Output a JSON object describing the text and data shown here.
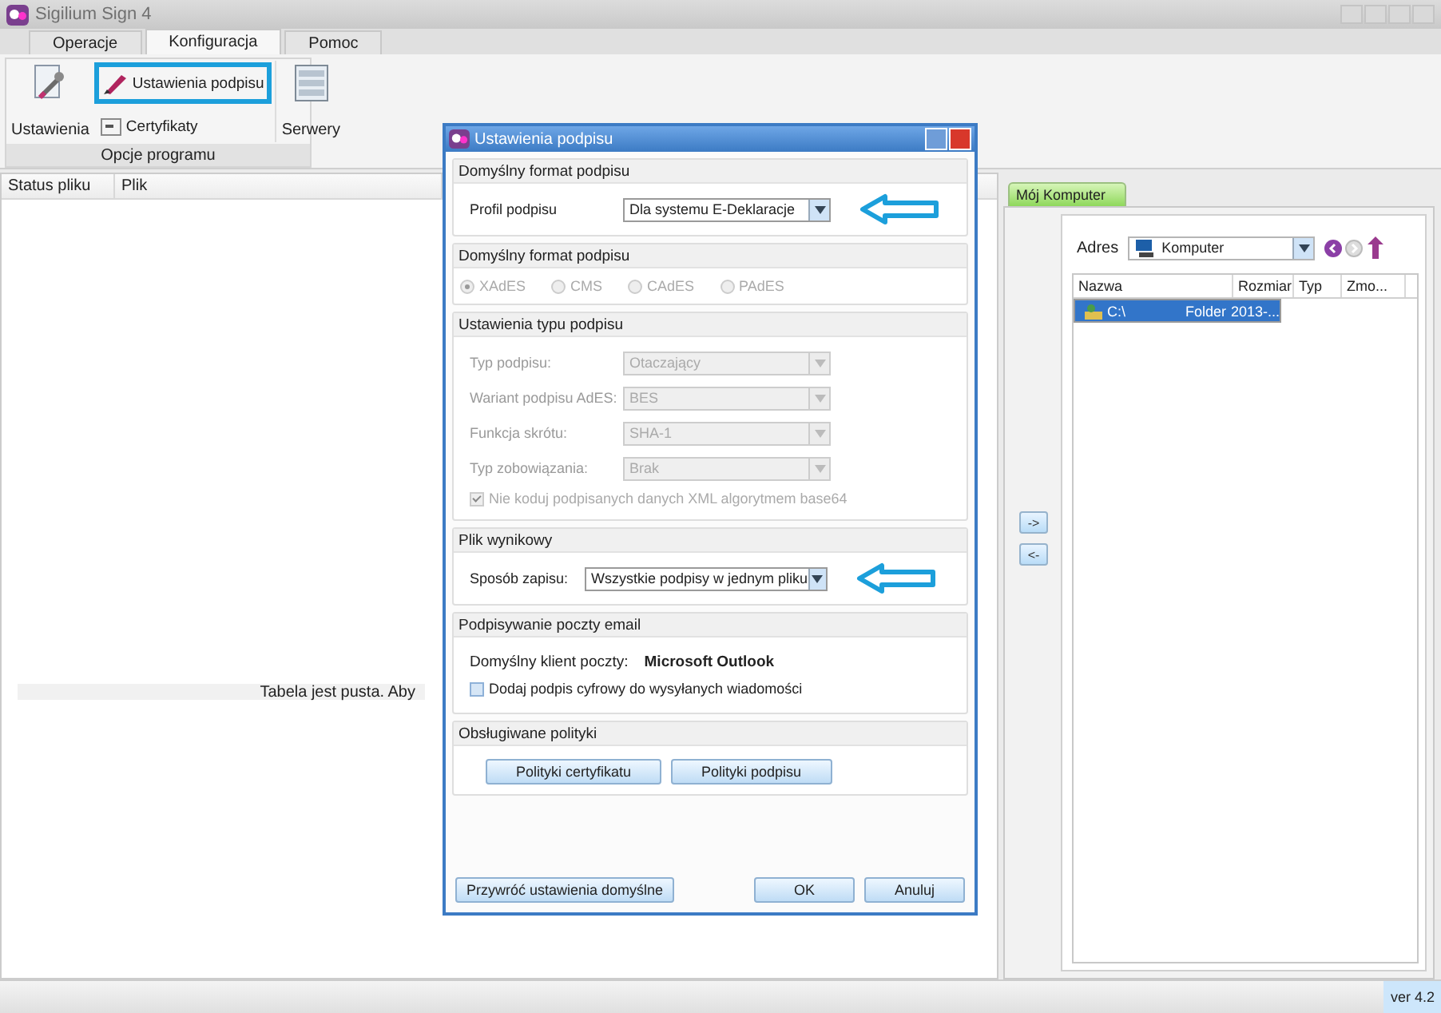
{
  "window": {
    "title": "Sigilium Sign 4"
  },
  "tabs": [
    {
      "label": "Operacje",
      "selected": false
    },
    {
      "label": "Konfiguracja",
      "selected": true
    },
    {
      "label": "Pomoc",
      "selected": false
    }
  ],
  "ribbon": {
    "group_label": "Opcje programu",
    "items": [
      {
        "kind": "large",
        "label": "Ustawienia",
        "highlighted": false
      },
      {
        "kind": "small",
        "label": "Ustawienia podpisu",
        "highlighted": true
      },
      {
        "kind": "small",
        "label": "Certyfikaty",
        "highlighted": false
      },
      {
        "kind": "large",
        "label": "Serwery",
        "highlighted": false
      }
    ]
  },
  "files_table": {
    "columns": [
      "Status pliku",
      "Plik"
    ],
    "empty_message": "Tabela jest pusta. Aby"
  },
  "transfer_buttons": [
    "->",
    "<-"
  ],
  "explorer": {
    "tab": {
      "label": "Mój Komputer",
      "selected": true
    },
    "address_label": "Adres",
    "address_value": "Komputer",
    "columns": [
      "Nazwa",
      "Rozmiar",
      "Typ",
      "Zmo..."
    ],
    "rows": [
      {
        "name": "C:\\",
        "type": "Folder",
        "modified": "2013-...",
        "selected": true
      }
    ]
  },
  "status_bar": {
    "version": "ver 4.2"
  },
  "dialog": {
    "title": "Ustawienia podpisu",
    "sections": [
      {
        "title": "Domyślny format podpisu",
        "rows": [
          {
            "label": "Profil podpisu",
            "value": "Dla systemu E-Deklaracje",
            "disabled": false,
            "arrow": true
          }
        ]
      },
      {
        "title": "Domyślny format podpisu",
        "radios": [
          {
            "label": "XAdES",
            "selected": true,
            "disabled": true
          },
          {
            "label": "CMS",
            "selected": false,
            "disabled": true
          },
          {
            "label": "CAdES",
            "selected": false,
            "disabled": true
          },
          {
            "label": "PAdES",
            "selected": false,
            "disabled": true
          }
        ]
      },
      {
        "title": "Ustawienia typu podpisu",
        "rows": [
          {
            "label": "Typ podpisu:",
            "value": "Otaczający",
            "disabled": true,
            "arrow": false
          },
          {
            "label": "Wariant podpisu AdES:",
            "value": "BES",
            "disabled": true,
            "arrow": false
          },
          {
            "label": "Funkcja skrótu:",
            "value": "SHA-1",
            "disabled": true,
            "arrow": false
          },
          {
            "label": "Typ zobowiązania:",
            "value": "Brak",
            "disabled": true,
            "arrow": false
          }
        ],
        "checkbox": {
          "label": "Nie koduj podpisanych danych XML algorytmem base64",
          "checked": true,
          "disabled": true
        }
      },
      {
        "title": "Plik wynikowy",
        "rows": [
          {
            "label": "Sposób zapisu:",
            "value": "Wszystkie podpisy w jednym pliku",
            "disabled": false,
            "arrow": true
          }
        ]
      },
      {
        "title": "Podpisywanie poczty email",
        "info": {
          "label": "Domyślny klient poczty:",
          "value": "Microsoft Outlook"
        },
        "checkbox": {
          "label": "Dodaj podpis cyfrowy do wysyłanych wiadomości",
          "checked": false,
          "disabled": false
        }
      },
      {
        "title": "Obsługiwane polityki",
        "buttons": [
          "Polityki certyfikatu",
          "Polityki podpisu"
        ]
      }
    ],
    "reset_button": "Przywróć ustawienia domyślne",
    "ok_button": "OK",
    "cancel_button": "Anuluj"
  }
}
